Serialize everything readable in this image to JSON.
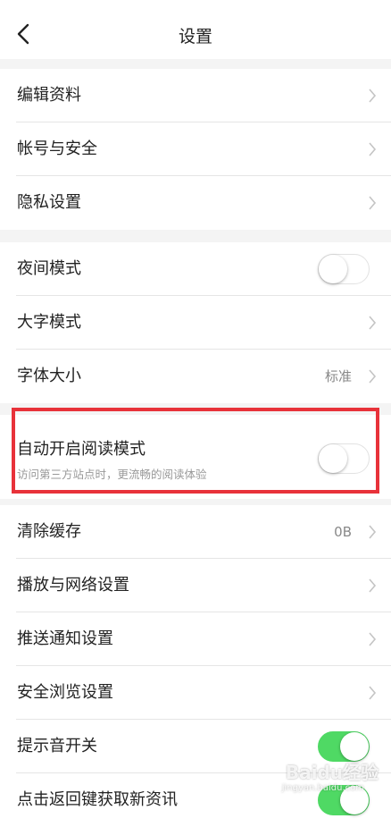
{
  "nav": {
    "title": "设置"
  },
  "group1": [
    {
      "label": "编辑资料"
    },
    {
      "label": "帐号与安全"
    },
    {
      "label": "隐私设置"
    }
  ],
  "group2": [
    {
      "label": "夜间模式",
      "control": "toggle",
      "on": false
    },
    {
      "label": "大字模式"
    },
    {
      "label": "字体大小",
      "value": "标准"
    }
  ],
  "reading_mode": {
    "label": "自动开启阅读模式",
    "sublabel": "访问第三方站点时，更流畅的阅读体验",
    "on": false
  },
  "group3": [
    {
      "label": "清除缓存",
      "value": "0B"
    },
    {
      "label": "播放与网络设置"
    },
    {
      "label": "推送通知设置"
    },
    {
      "label": "安全浏览设置"
    },
    {
      "label": "提示音开关",
      "control": "toggle",
      "on": true
    },
    {
      "label": "点击返回键获取新资讯",
      "control": "toggle",
      "on": true
    }
  ],
  "watermark": {
    "brand": "Baidu经验",
    "url": "jingyan.baidu.com"
  },
  "colors": {
    "toggle_on": "#4fd964",
    "highlight": "#e8323a",
    "background": "#f4f4f4"
  }
}
